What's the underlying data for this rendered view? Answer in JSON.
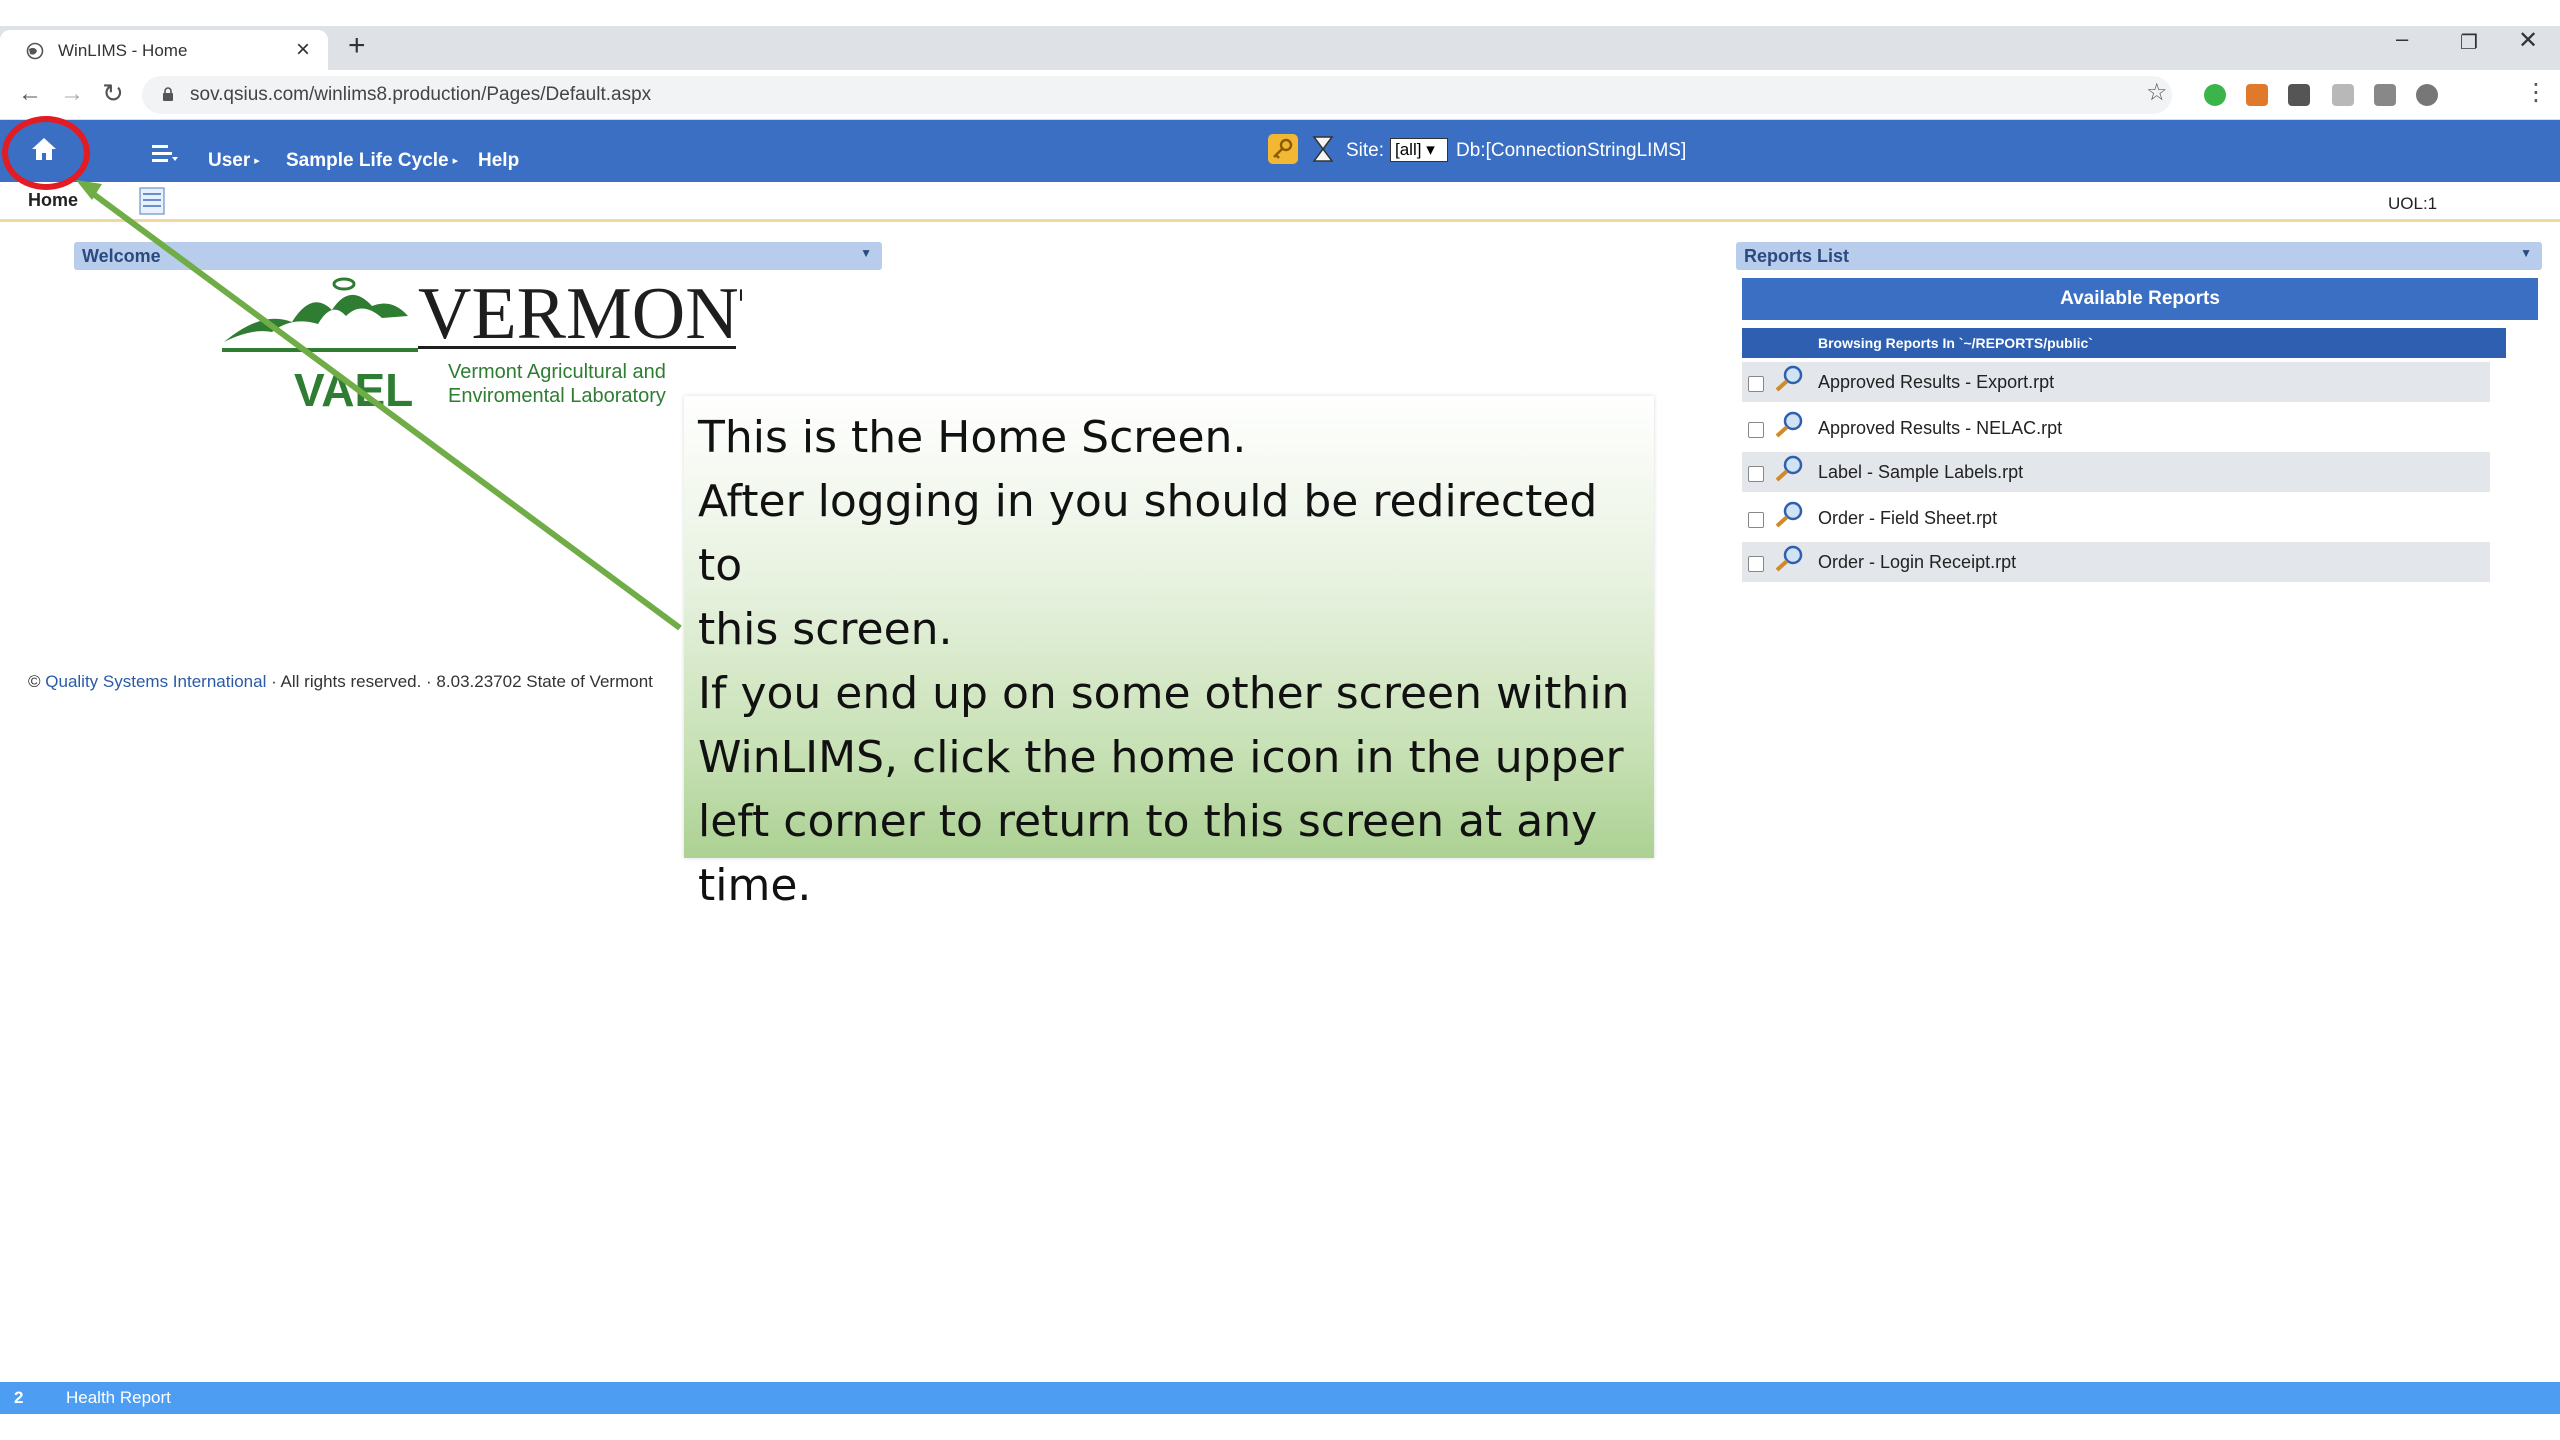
{
  "browser": {
    "tab_title": "WinLIMS - Home",
    "url": "sov.qsius.com/winlims8.production/Pages/Default.aspx"
  },
  "header": {
    "menu": [
      "User",
      "Sample Life Cycle",
      "Help"
    ],
    "site_label": "Site:",
    "site_value": "[all]",
    "db_label": "Db:[ConnectionStringLIMS]"
  },
  "subbar": {
    "home_label": "Home",
    "uol": "UOL:1"
  },
  "welcome": {
    "title": "Welcome",
    "logo": {
      "brand": "VERMONT",
      "acronym": "VAEL",
      "line1": "Vermont Agricultural and",
      "line2": "Enviromental Laboratory"
    }
  },
  "footer": {
    "copyright_prefix": "©",
    "company": "Quality Systems International",
    "suffix": "· All rights reserved. · 8.03.23702 State of Vermont"
  },
  "reports": {
    "title": "Reports List",
    "available": "Available Reports",
    "browsing": "Browsing Reports In `~/REPORTS/public`",
    "items": [
      "Approved Results - Export.rpt",
      "Approved Results - NELAC.rpt",
      "Label - Sample Labels.rpt",
      "Order - Field Sheet.rpt",
      "Order - Login Receipt.rpt"
    ]
  },
  "annotation": {
    "lines": [
      "This is the Home Screen.",
      "After logging in you should be redirected to",
      "this screen.",
      "If you end up on some other screen within",
      "WinLIMS, click the home icon in the upper",
      "left corner to return to this screen at any",
      "time."
    ]
  },
  "status": {
    "number": "2",
    "label": "Health Report"
  },
  "colors": {
    "header_blue": "#3a6fc4",
    "panel_bar": "#b8cdeb",
    "status_blue": "#4d9ef2",
    "highlight_red": "#e31b23",
    "arrow_green": "#70ad47"
  }
}
